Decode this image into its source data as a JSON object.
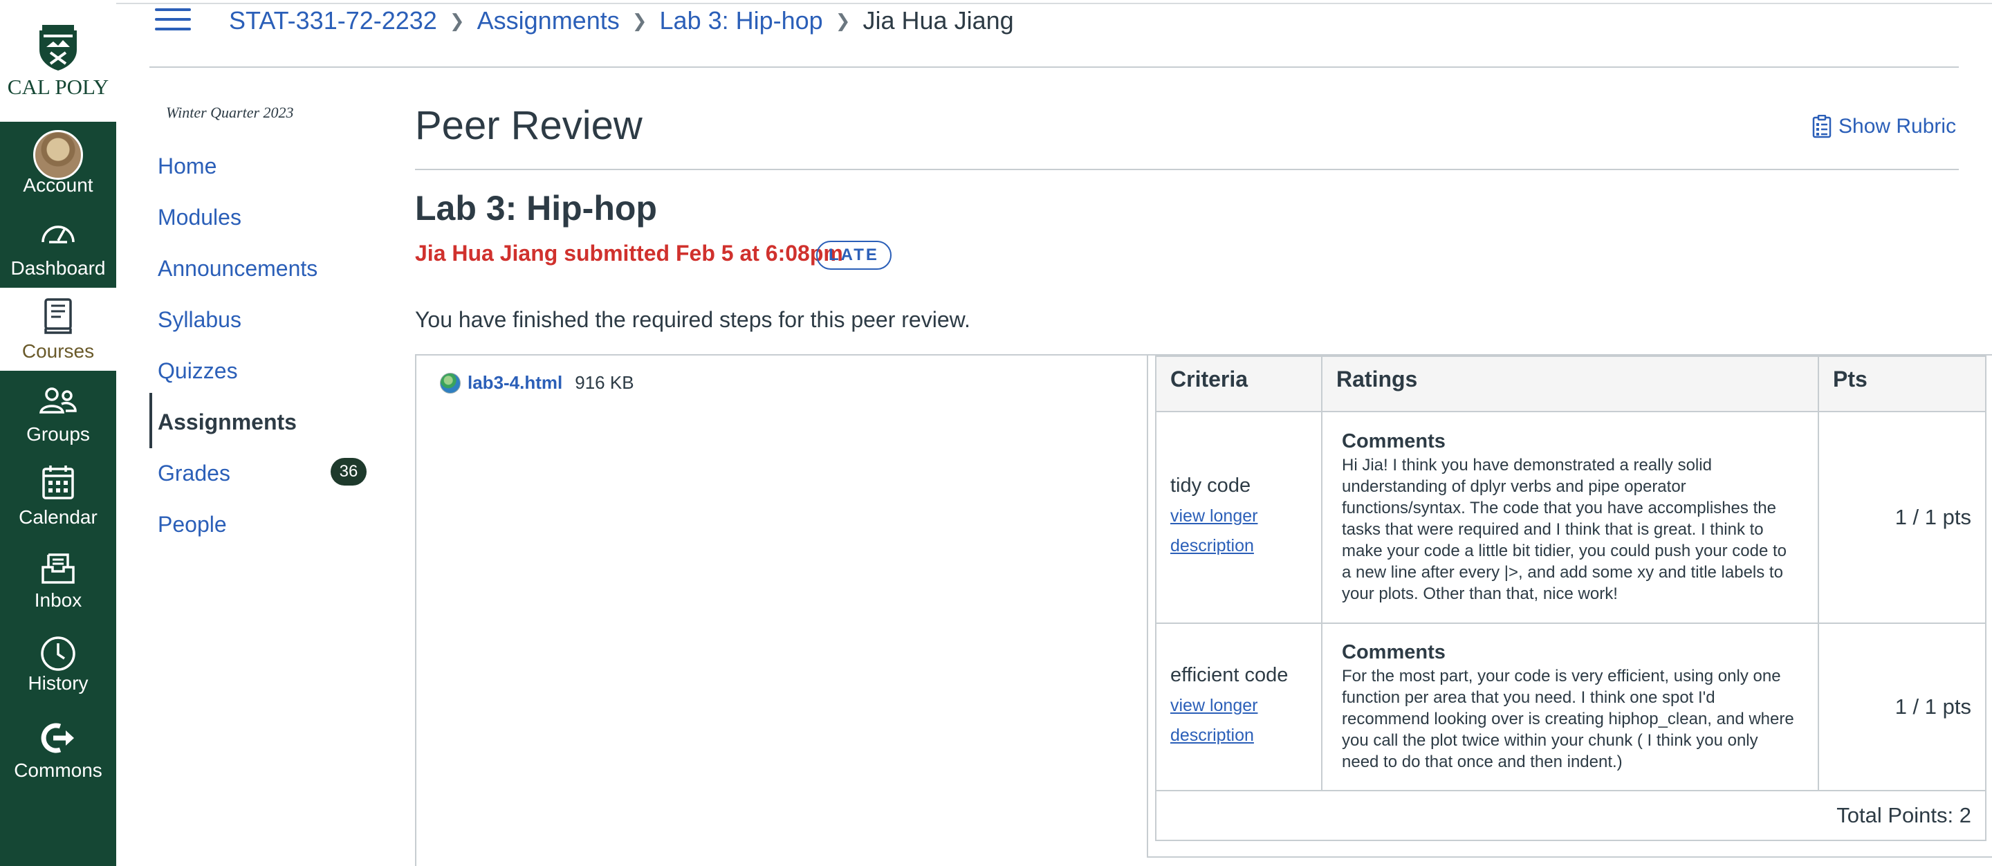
{
  "global_nav": {
    "logo_text": "CAL POLY",
    "items": [
      {
        "label": "Account",
        "icon": "avatar"
      },
      {
        "label": "Dashboard",
        "icon": "dashboard-icon"
      },
      {
        "label": "Courses",
        "icon": "book-icon"
      },
      {
        "label": "Groups",
        "icon": "groups-icon"
      },
      {
        "label": "Calendar",
        "icon": "calendar-icon"
      },
      {
        "label": "Inbox",
        "icon": "inbox-icon"
      },
      {
        "label": "History",
        "icon": "clock-icon"
      },
      {
        "label": "Commons",
        "icon": "commons-icon"
      }
    ],
    "active": "Courses",
    "brand_color": "#154734"
  },
  "breadcrumb": {
    "items": [
      "STAT-331-72-2232",
      "Assignments",
      "Lab 3: Hip-hop"
    ],
    "current": "Jia Hua Jiang"
  },
  "course_nav": {
    "term": "Winter Quarter 2023",
    "items": [
      "Home",
      "Modules",
      "Announcements",
      "Syllabus",
      "Quizzes",
      "Assignments",
      "Grades",
      "People"
    ],
    "active": "Assignments",
    "grades_badge": "36"
  },
  "main": {
    "page_title": "Peer Review",
    "show_rubric": "Show Rubric",
    "assignment_title": "Lab 3: Hip-hop",
    "submitted_text": "Jia Hua Jiang submitted Feb 5 at 6:08pm",
    "late_label": "LATE",
    "finished_message": "You have finished the required steps for this peer review."
  },
  "submission": {
    "file_name": "lab3-4.html",
    "file_size": "916 KB"
  },
  "rubric": {
    "headers": [
      "Criteria",
      "Ratings",
      "Pts"
    ],
    "rows": [
      {
        "criterion": "tidy code",
        "link": "view longer description",
        "comments_label": "Comments",
        "comment": "Hi Jia! I think you have demonstrated a really solid understanding of dplyr verbs and pipe operator functions/syntax. The code that you have accomplishes the tasks that were required and I think that is great. I think to make your code a little bit tidier, you could push your code to a new line after every |>, and add some xy and title labels to your plots. Other than that, nice work!",
        "points": "1 / 1 pts"
      },
      {
        "criterion": "efficient code",
        "link": "view longer description",
        "comments_label": "Comments",
        "comment": "For the most part, your code is very efficient, using only one function per area that you need. I think one spot I'd recommend looking over is creating hiphop_clean, and where you call the plot twice within your chunk ( I think you only need to do that once and then indent.)",
        "points": "1 / 1 pts"
      }
    ],
    "total": "Total Points: 2"
  },
  "colors": {
    "link": "#2b5fb8",
    "late_red": "#d0312d",
    "text": "#2d3b45",
    "border": "#c7cdd1"
  }
}
